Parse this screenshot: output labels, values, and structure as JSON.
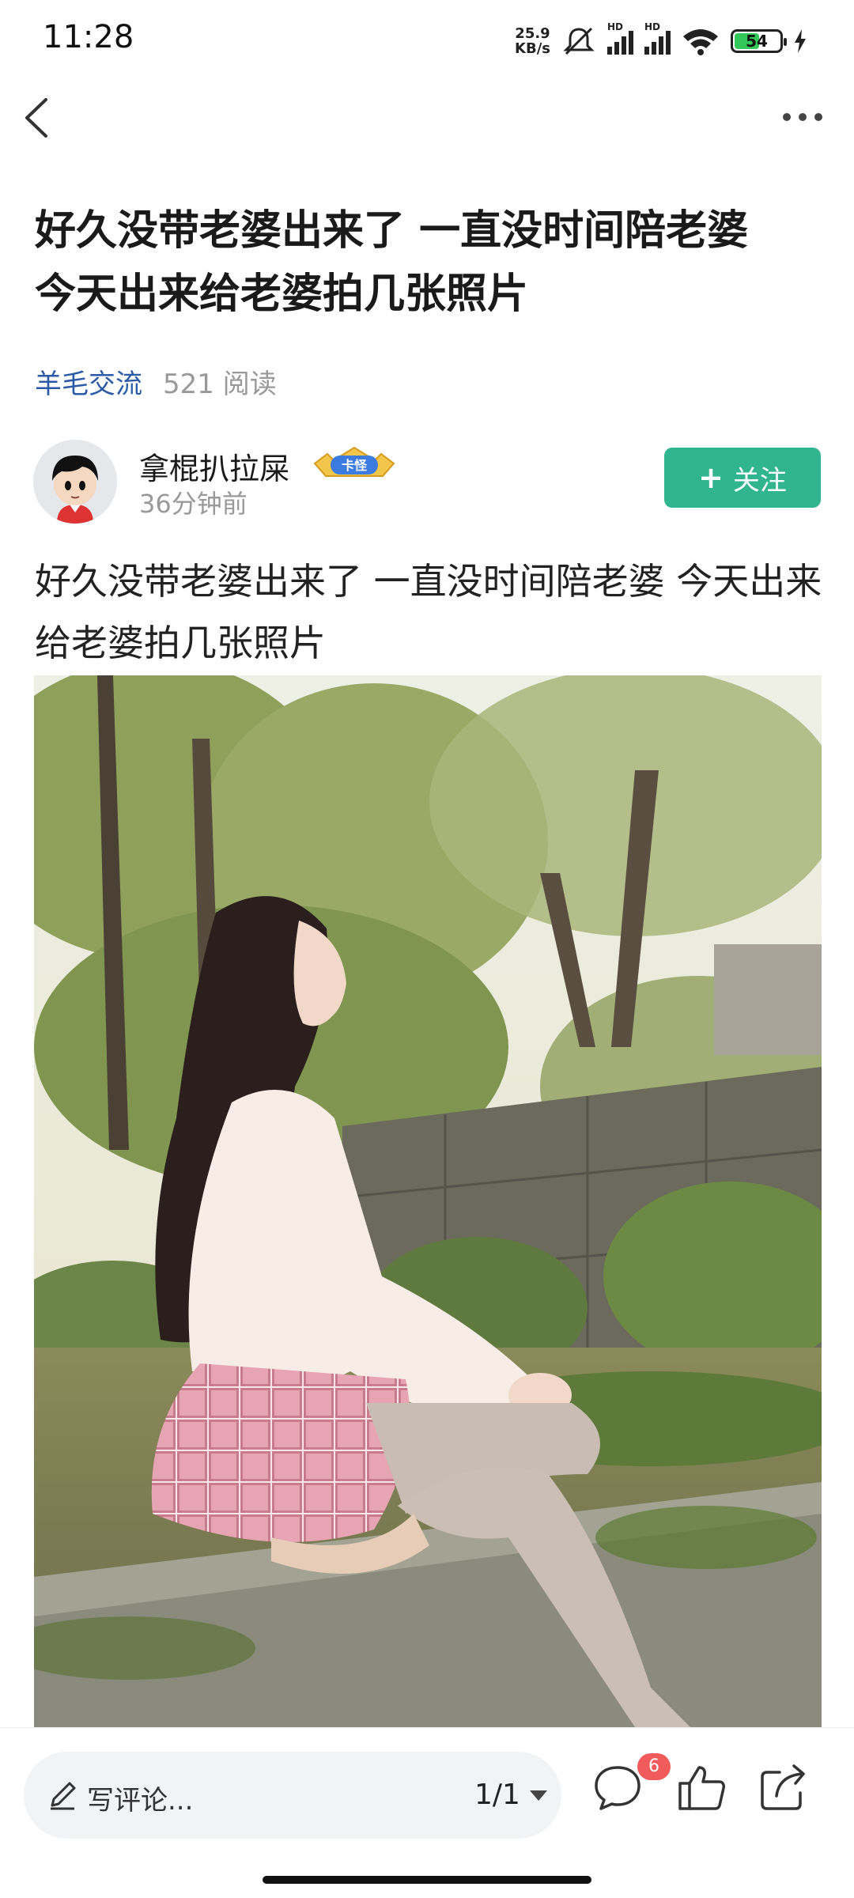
{
  "status_bar": {
    "time": "11:28",
    "net_speed_value": "25.9",
    "net_speed_unit": "KB/s",
    "signal_1_label": "HD",
    "signal_2_label": "HD",
    "battery_level": "54",
    "icons": [
      "mute-icon",
      "signal-icon",
      "wifi-icon",
      "battery-icon",
      "charging-icon"
    ]
  },
  "nav": {
    "back_icon": "chevron-left-icon",
    "more_icon": "more-dots-icon"
  },
  "post": {
    "title": "好久没带老婆出来了 一直没时间陪老婆 今天出来给老婆拍几张照片",
    "category": "羊毛交流",
    "read_count": "521 阅读",
    "author": {
      "name": "拿棍扒拉屎",
      "badge": "卡怪",
      "time": "36分钟前"
    },
    "follow_label": "关注",
    "body": "好久没带老婆出来了 一直没时间陪老婆 今天出来给老婆拍几张照片"
  },
  "bottom_bar": {
    "comment_placeholder": "写评论...",
    "page_indicator": "1/1",
    "comment_count": "6"
  },
  "colors": {
    "accent_green": "#31b58f",
    "link_blue": "#2b5aa6",
    "badge_red": "#f15b5b"
  }
}
